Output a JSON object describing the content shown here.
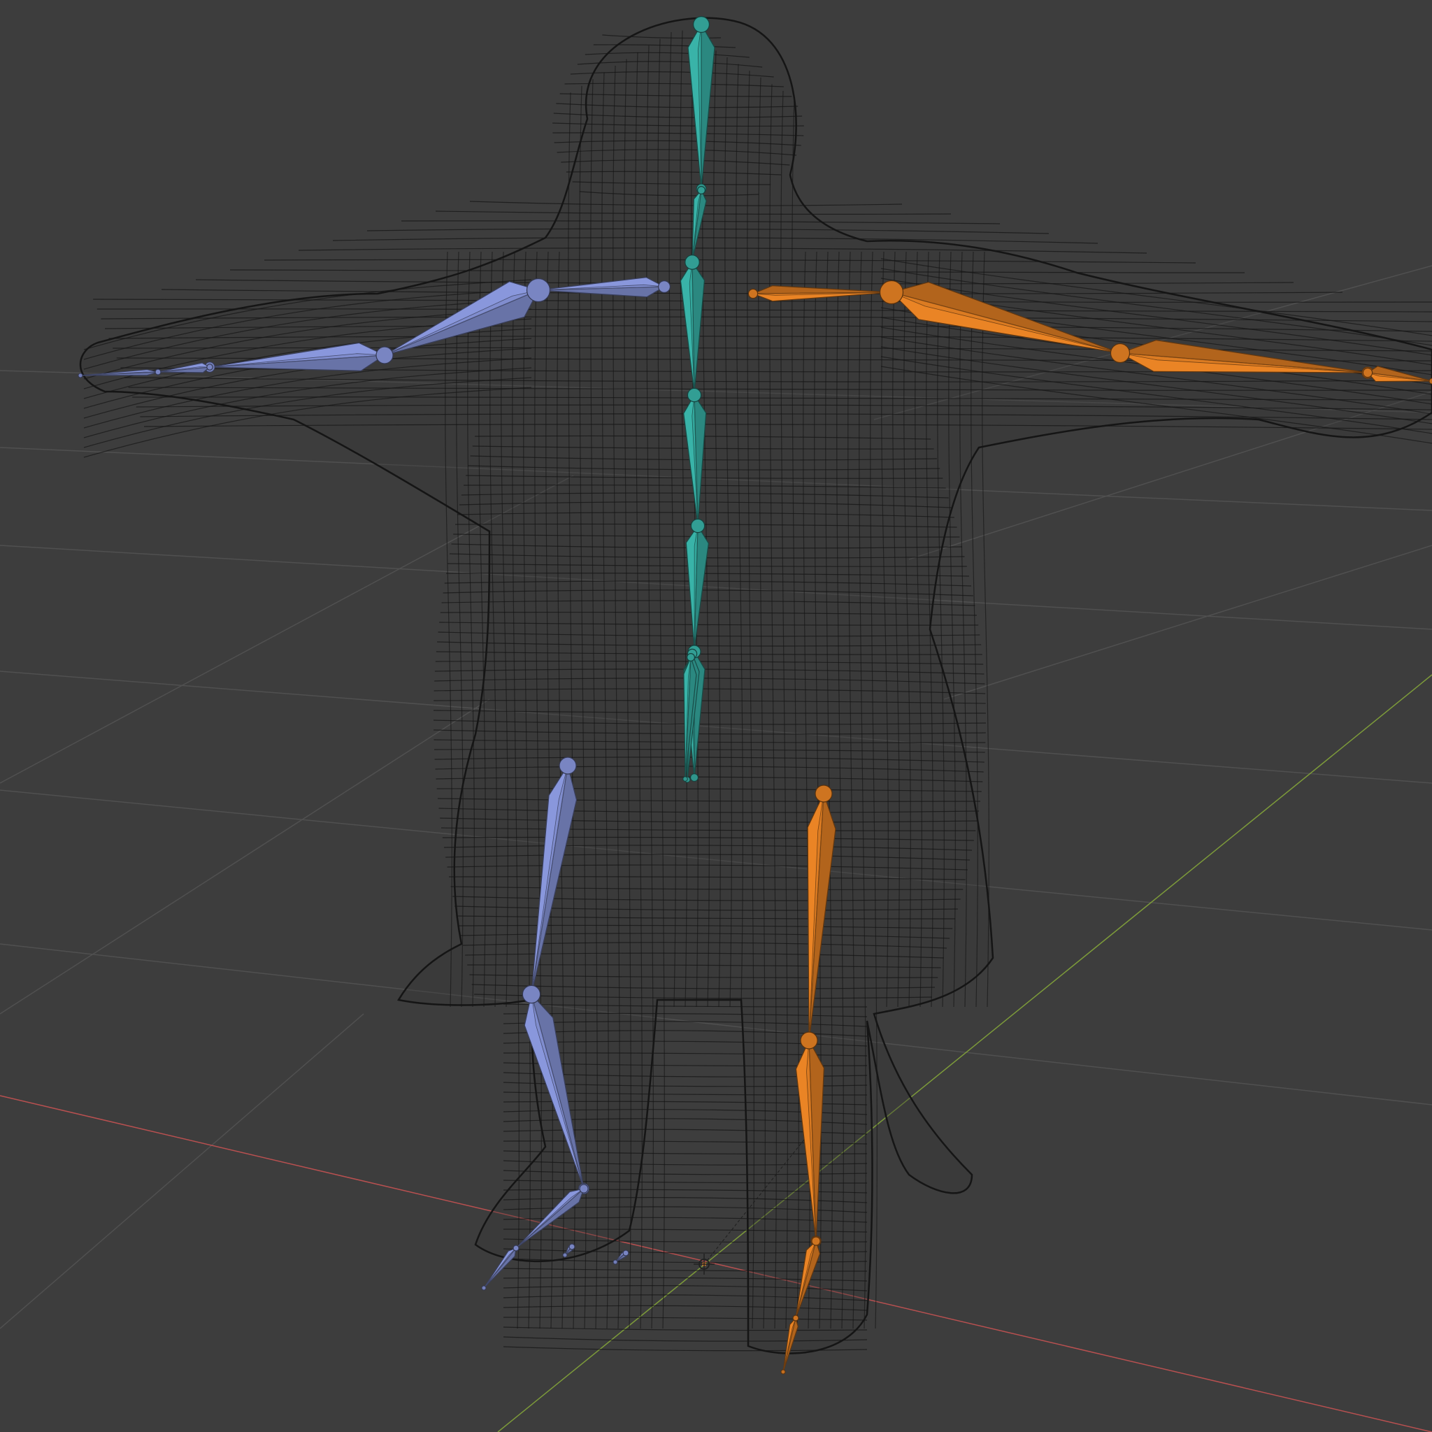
{
  "viewport": {
    "background": "#3d3d3d",
    "grid_color": "#505050",
    "x_axis_color": "#b85050",
    "y_axis_color": "#7d9b3a",
    "wireframe_color": "#151515"
  },
  "bone_colors": {
    "center": "#35a69c",
    "left": "#7f8ccc",
    "right": "#d97a22"
  },
  "armature": {
    "bone_count": 27,
    "side_groups": [
      "center",
      "left",
      "right"
    ]
  },
  "icons": {
    "origin": "3d-cursor-icon"
  }
}
